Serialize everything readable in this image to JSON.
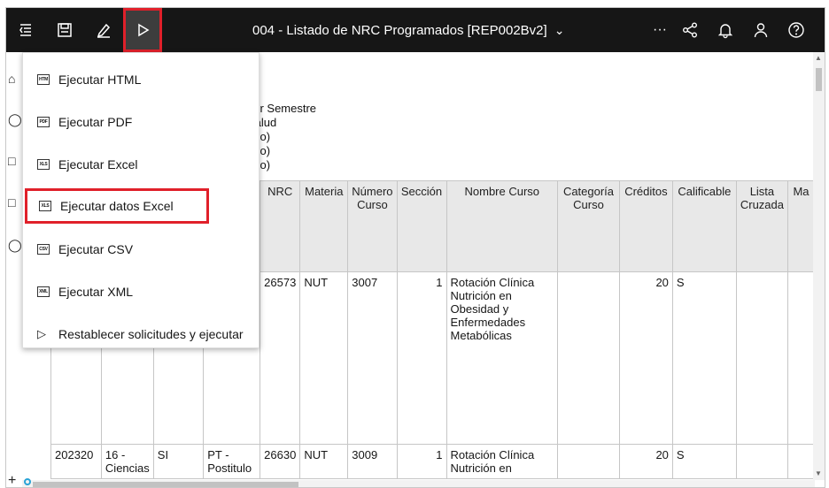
{
  "toolbar": {
    "report_title": "004 - Listado de NRC Programados [REP002Bv2]",
    "icons": [
      "sidebar-toggle-icon",
      "save-icon",
      "edit-icon",
      "run-icon",
      "more-icon",
      "share-icon",
      "notifications-icon",
      "user-icon",
      "help-icon"
    ],
    "more_label": "···",
    "accent": "#e0202a"
  },
  "run_menu": {
    "items": [
      {
        "label": "Ejecutar HTML",
        "icon": "HTM"
      },
      {
        "label": "Ejecutar PDF",
        "icon": "PDF"
      },
      {
        "label": "Ejecutar Excel",
        "icon": "XLS"
      },
      {
        "label": "Ejecutar datos Excel",
        "icon": "XLS",
        "highlighted": true
      },
      {
        "label": "Ejecutar CSV",
        "icon": "CSV"
      },
      {
        "label": "Ejecutar XML",
        "icon": "XML"
      },
      {
        "label": "Restablecer solicitudes y ejecutar",
        "icon": "play"
      }
    ]
  },
  "report_meta": {
    "lines": [
      "ner Semestre",
      "Salud",
      "ado)",
      "ado)",
      "ado)"
    ]
  },
  "table": {
    "headers": [
      "",
      "",
      "",
      "",
      "NRC",
      "Materia",
      "Número Curso",
      "Sección",
      "Nombre Curso",
      "Categoría Curso",
      "Créditos",
      "Calificable",
      "Lista Cruzada",
      "Ma"
    ],
    "rows": [
      [
        "",
        "",
        "",
        "",
        "26573",
        "NUT",
        "3007",
        "1",
        "Rotación Clínica Nutrición en Obesidad y Enfermedades Metabólicas",
        "",
        "20",
        "S",
        "",
        ""
      ],
      [
        "202320",
        "16 - Ciencias",
        "SI",
        "PT - Postitulo",
        "26630",
        "NUT",
        "3009",
        "1",
        "Rotación Clínica Nutrición en",
        "",
        "20",
        "S",
        "",
        ""
      ]
    ]
  }
}
